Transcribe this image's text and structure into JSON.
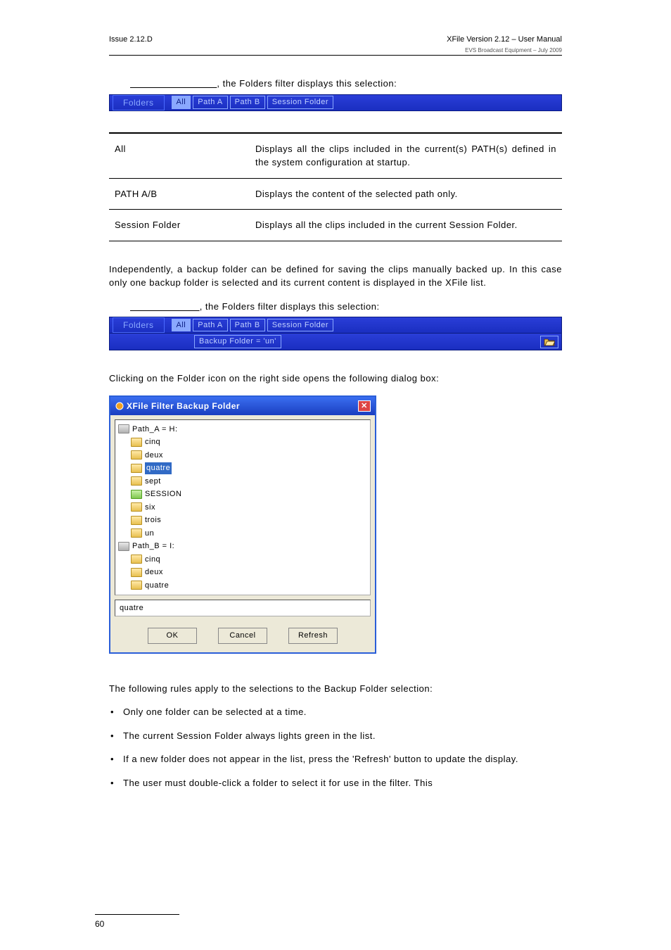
{
  "header": {
    "issue": "Issue 2.12.D",
    "title": "XFile Version 2.12 – User Manual",
    "sub": "EVS Broadcast Equipment – July 2009"
  },
  "intro1_suffix": ", the Folders filter displays this selection:",
  "folders_bar": {
    "label": "Folders",
    "chips": [
      "All",
      "Path A",
      "Path B",
      "Session Folder"
    ]
  },
  "def_table": [
    {
      "term": "All",
      "desc": "Displays all the clips included in the current(s) PATH(s) defined in the system configuration at startup."
    },
    {
      "term": "PATH A/B",
      "desc": "Displays the content of the selected path only."
    },
    {
      "term": "Session Folder",
      "desc": "Displays all the clips included in the current Session Folder."
    }
  ],
  "para_backup": "Independently, a backup folder can be defined for saving the clips manually backed up. In this case only one backup folder is selected and its current content is displayed in the XFile list.",
  "intro2_suffix": ", the Folders filter displays this selection:",
  "backup_chip": "Backup Folder  = 'un'",
  "para_click": "Clicking on the Folder icon on the right side opens the following dialog box:",
  "dialog": {
    "title": "XFile Filter Backup Folder",
    "tree": [
      {
        "label": "Path_A = H:",
        "type": "drive",
        "indent": 0
      },
      {
        "label": "cinq",
        "type": "closed",
        "indent": 1
      },
      {
        "label": "deux",
        "type": "closed",
        "indent": 1
      },
      {
        "label": "quatre",
        "type": "closed",
        "indent": 1,
        "selected": true
      },
      {
        "label": "sept",
        "type": "closed",
        "indent": 1
      },
      {
        "label": "SESSION",
        "type": "open",
        "indent": 1
      },
      {
        "label": "six",
        "type": "closed",
        "indent": 1
      },
      {
        "label": "trois",
        "type": "closed",
        "indent": 1
      },
      {
        "label": "un",
        "type": "closed",
        "indent": 1
      },
      {
        "label": "Path_B = I:",
        "type": "drive",
        "indent": 0
      },
      {
        "label": "cinq",
        "type": "closed",
        "indent": 1
      },
      {
        "label": "deux",
        "type": "closed",
        "indent": 1
      },
      {
        "label": "quatre",
        "type": "closed",
        "indent": 1
      }
    ],
    "selected_value": "quatre",
    "buttons": {
      "ok": "OK",
      "cancel": "Cancel",
      "refresh": "Refresh"
    }
  },
  "para_rules_intro": "The following rules apply to the selections to the Backup Folder selection:",
  "rules": [
    "Only one folder can be selected at a time.",
    "The current Session Folder always lights green in the list.",
    "If a new folder does not appear in the list, press the 'Refresh' button to update the display.",
    "The user must double-click a folder to select it for use in the filter. This"
  ],
  "page_number": "60"
}
